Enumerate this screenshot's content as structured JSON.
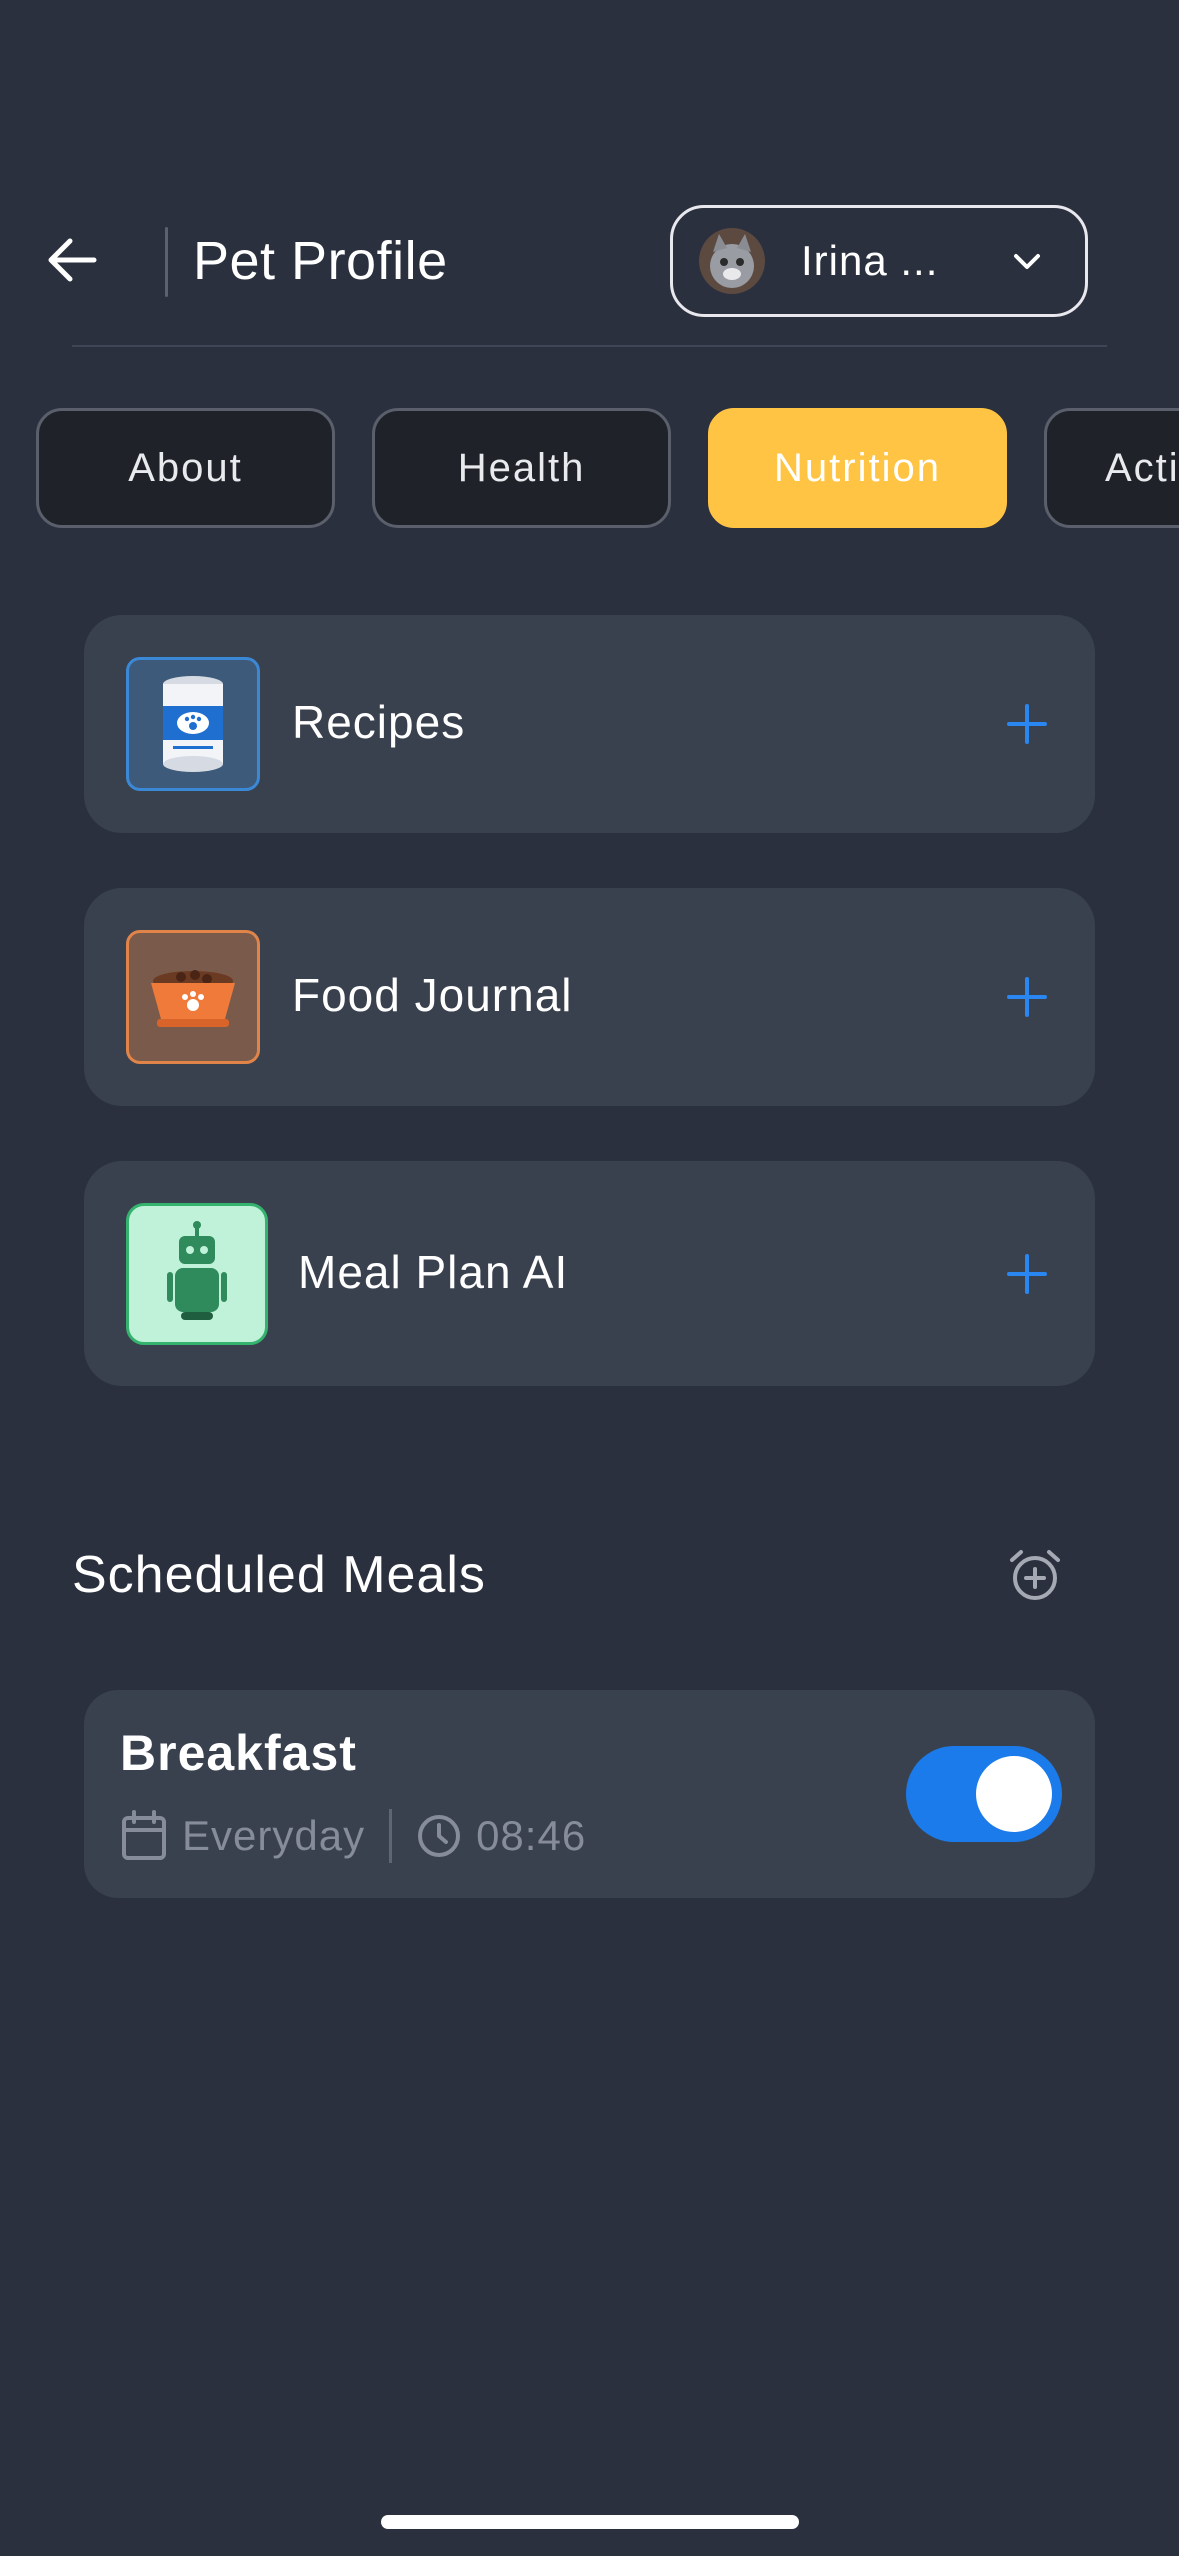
{
  "header": {
    "title": "Pet Profile",
    "pet_selector": {
      "name": "Irina ..."
    }
  },
  "tabs": [
    {
      "label": "About",
      "active": false
    },
    {
      "label": "Health",
      "active": false
    },
    {
      "label": "Nutrition",
      "active": true
    },
    {
      "label": "Acti",
      "active": false
    }
  ],
  "features": [
    {
      "label": "Recipes",
      "icon": "pet-food-can-icon"
    },
    {
      "label": "Food Journal",
      "icon": "pet-bowl-icon"
    },
    {
      "label": "Meal Plan AI",
      "icon": "robot-icon"
    }
  ],
  "scheduled": {
    "title": "Scheduled Meals",
    "meals": [
      {
        "name": "Breakfast",
        "repeat": "Everyday",
        "time": "08:46",
        "enabled": true
      }
    ]
  },
  "colors": {
    "background": "#2a303d",
    "card": "#3a414e",
    "accent_yellow": "#ffc443",
    "accent_blue": "#1b7bea"
  }
}
